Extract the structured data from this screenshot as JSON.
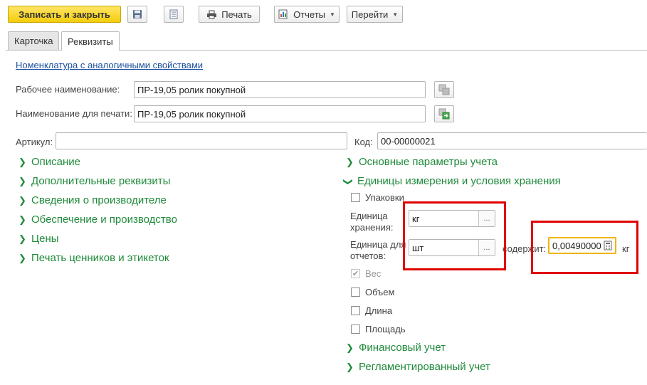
{
  "toolbar": {
    "save_close_label": "Записать и закрыть",
    "print_label": "Печать",
    "reports_label": "Отчеты",
    "goto_label": "Перейти"
  },
  "tabs": [
    {
      "label": "Карточка",
      "active": false
    },
    {
      "label": "Реквизиты",
      "active": true
    }
  ],
  "analog_link": "Номенклатура с аналогичными свойствами",
  "work_name": {
    "label": "Рабочее наименование:",
    "value": "ПР-19,05 ролик покупной"
  },
  "print_name": {
    "label": "Наименование для печати:",
    "value": "ПР-19,05 ролик покупной"
  },
  "article": {
    "label": "Артикул:",
    "value": ""
  },
  "code": {
    "label": "Код:",
    "value": "00-00000021"
  },
  "left_groups": [
    "Описание",
    "Дополнительные реквизиты",
    "Сведения о производителе",
    "Обеспечение и производство",
    "Цены",
    "Печать ценников и этикеток"
  ],
  "right_groups": {
    "main_params": "Основные параметры учета",
    "units": "Единицы измерения и условия хранения",
    "financial": "Финансовый учет",
    "regulated": "Регламентированный учет"
  },
  "units_section": {
    "packages_label": "Упаковки",
    "storage_unit_label_1": "Единица",
    "storage_unit_label_2": "хранения:",
    "storage_unit_value": "кг",
    "report_unit_label_1": "Единица для",
    "report_unit_label_2": "отчетов:",
    "report_unit_value": "шт",
    "contains_label": "содержит:",
    "contains_value": "0,00490000",
    "contains_unit": "кг",
    "dots": "...",
    "checkboxes": [
      {
        "label": "Вес",
        "checked": true,
        "disabled": true
      },
      {
        "label": "Объем",
        "checked": false,
        "disabled": false
      },
      {
        "label": "Длина",
        "checked": false,
        "disabled": false
      },
      {
        "label": "Площадь",
        "checked": false,
        "disabled": false
      }
    ]
  },
  "colors": {
    "accent_yellow": "#f5cd0c",
    "group_green": "#1f8a3a",
    "link_blue": "#1a4fa0",
    "highlight_red": "#e00000",
    "focus_orange": "#f0b400"
  }
}
